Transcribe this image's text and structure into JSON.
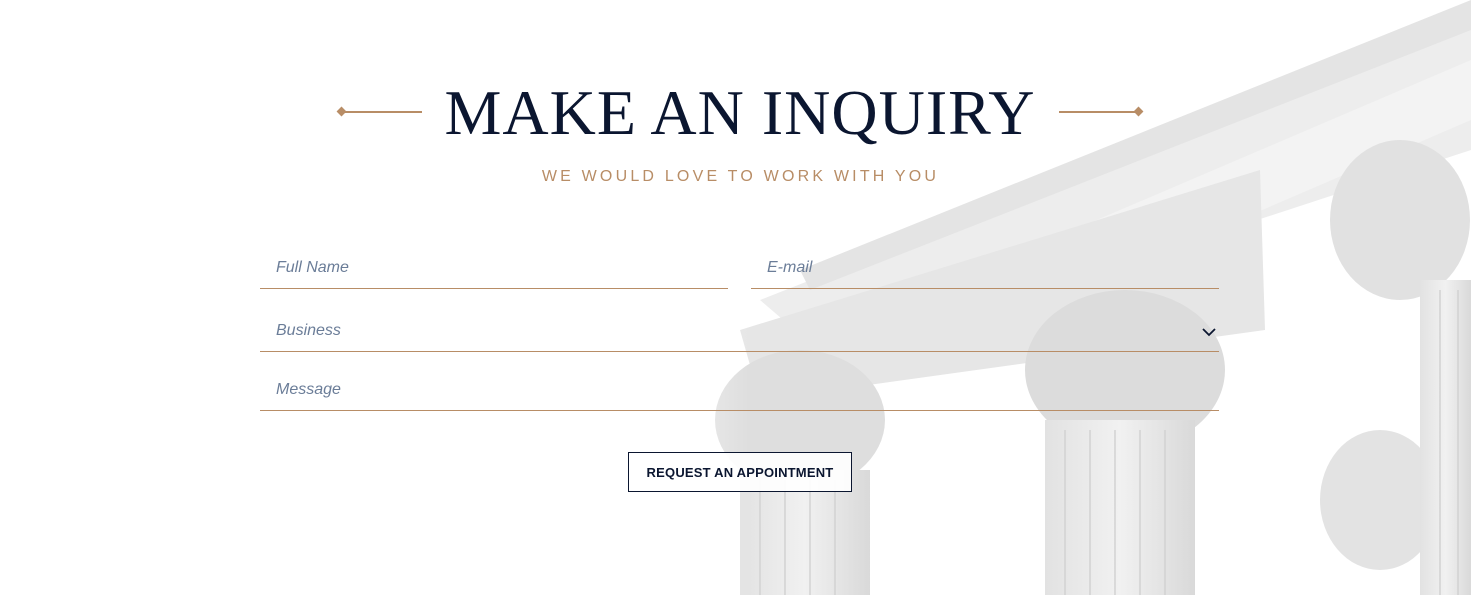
{
  "header": {
    "title": "MAKE AN INQUIRY",
    "subtitle": "WE WOULD LOVE TO WORK WITH YOU"
  },
  "form": {
    "full_name": {
      "placeholder": "Full Name",
      "value": ""
    },
    "email": {
      "placeholder": "E-mail",
      "value": ""
    },
    "business": {
      "selected": "Business"
    },
    "message": {
      "placeholder": "Message",
      "value": ""
    },
    "submit_label": "REQUEST AN APPOINTMENT"
  },
  "colors": {
    "accent": "#b88d66",
    "navy": "#0b1630",
    "placeholder": "#6b7d98"
  },
  "icons": {
    "select": "chevron-down-icon",
    "ornament": "diamond-line-ornament"
  }
}
